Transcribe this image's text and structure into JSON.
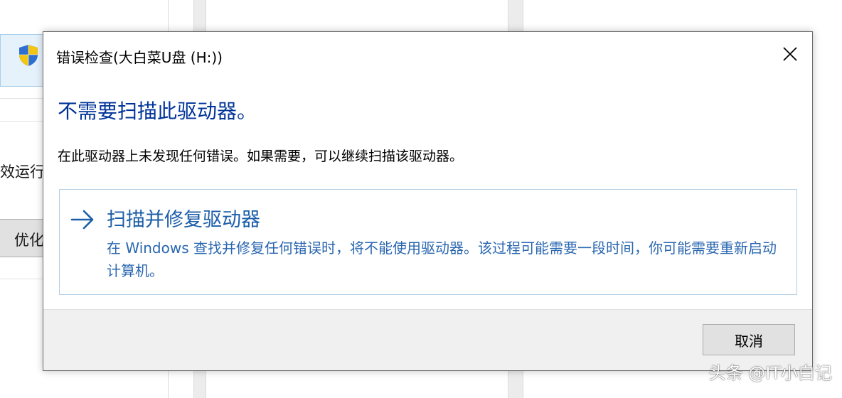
{
  "background_window": {
    "text_fragment_1": "效运行",
    "button_fragment": "优化"
  },
  "dialog": {
    "title": "错误检查(大白菜U盘 (H:))",
    "heading": "不需要扫描此驱动器。",
    "description": "在此驱动器上未发现任何错误。如果需要，可以继续扫描该驱动器。",
    "command_link": {
      "title": "扫描并修复驱动器",
      "description": "在 Windows 查找并修复任何错误时，将不能使用驱动器。该过程可能需要一段时间，你可能需要重新启动计算机。"
    },
    "cancel_label": "取消"
  },
  "watermark": "头条 @IT小白记",
  "colors": {
    "heading": "#003399",
    "link_title": "#1c5ea8",
    "link_text": "#2a67b0",
    "link_border": "#b5cfe4"
  },
  "icons": {
    "shield": "uac-shield-icon",
    "close": "close-icon",
    "arrow": "arrow-right-icon"
  }
}
